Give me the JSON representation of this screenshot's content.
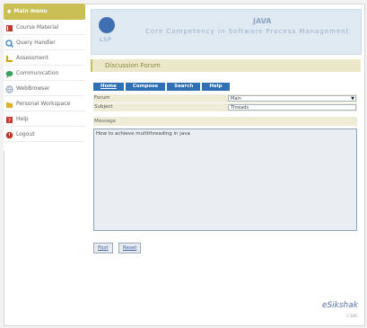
{
  "sidebar": {
    "main_menu": "Main menu",
    "items": [
      {
        "label": "Course Material",
        "icon": "book-icon",
        "color": "#c0392b"
      },
      {
        "label": "Query Handler",
        "icon": "magnifier-icon",
        "color": "#2d7fb8"
      },
      {
        "label": "Assessment",
        "icon": "ruler-icon",
        "color": "#d8a200"
      },
      {
        "label": "Communication",
        "icon": "speech-icon",
        "color": "#3aa15f"
      },
      {
        "label": "WebBrowser",
        "icon": "globe-icon",
        "color": "#8aa0b5"
      },
      {
        "label": "Personal Workspace",
        "icon": "folder-icon",
        "color": "#e0b325"
      },
      {
        "label": "Help",
        "icon": "help-icon",
        "color": "#c0392b"
      },
      {
        "label": "Logout",
        "icon": "power-icon",
        "color": "#c0392b"
      }
    ]
  },
  "header": {
    "title": "JAVA",
    "subtitle": "Core Competency in Software Process Management",
    "logo_text": "LSP"
  },
  "forum": {
    "heading": "Discussion Forum",
    "tabs": [
      "Home",
      "Compose",
      "Search",
      "Help"
    ],
    "forum_label": "Forum",
    "forum_value": "Main",
    "subject_label": "Subject",
    "subject_value": "Threads",
    "message_label": "Message",
    "message_value": "How to achieve multithreading in java",
    "post_label": "Post",
    "reset_label": "Reset"
  },
  "footer": {
    "brand": "eSikshak",
    "brand_sub": "C-DAC"
  },
  "colors": {
    "accent_gold": "#c9bf55",
    "tab_blue": "#2f6fb4",
    "header_bg": "#dfe9f2"
  }
}
